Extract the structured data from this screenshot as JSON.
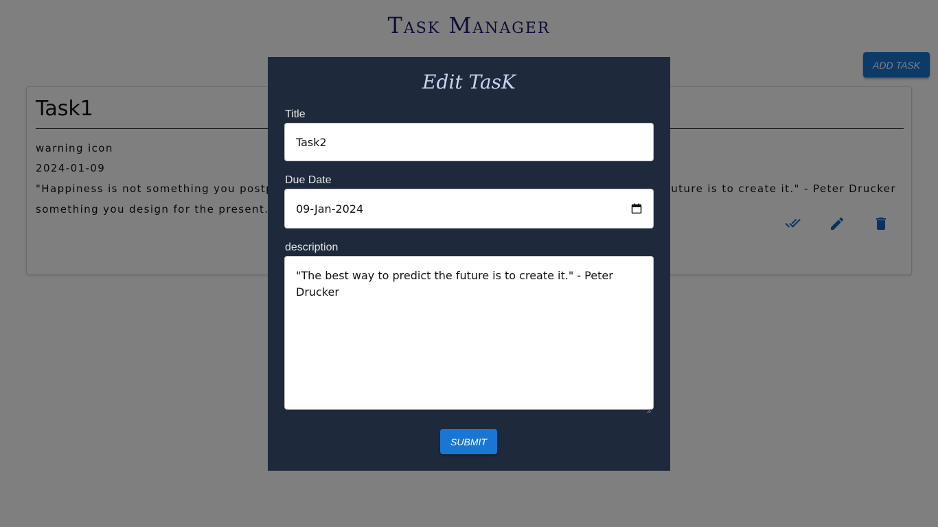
{
  "app": {
    "title": "Task Manager",
    "add_task_label": "ADD TASK"
  },
  "task_card": {
    "title": "Task1",
    "icon_text": "warning icon",
    "date": "2024-01-09",
    "description_line1": "\"Happiness is not something you postp",
    "description_line1_end": "uture is to create it.\" - Peter Drucker",
    "description_line2": "something you design for the present.",
    "icons": [
      "double-check-icon",
      "pencil-icon",
      "trash-icon"
    ],
    "icon_color": "#1565c0"
  },
  "modal": {
    "title": "Edit TasK",
    "title_label": "Title",
    "title_value": "Task2",
    "due_date_label": "Due Date",
    "due_date_value": "09-Jan-2024",
    "description_label": "description",
    "description_value": "\"The best way to predict the future is to create it.\" - Peter Drucker",
    "submit_label": "SUBMIT"
  },
  "colors": {
    "modal_background": "#1e293b",
    "accent": "#1976d2",
    "app_title": "#1b1b6e"
  }
}
